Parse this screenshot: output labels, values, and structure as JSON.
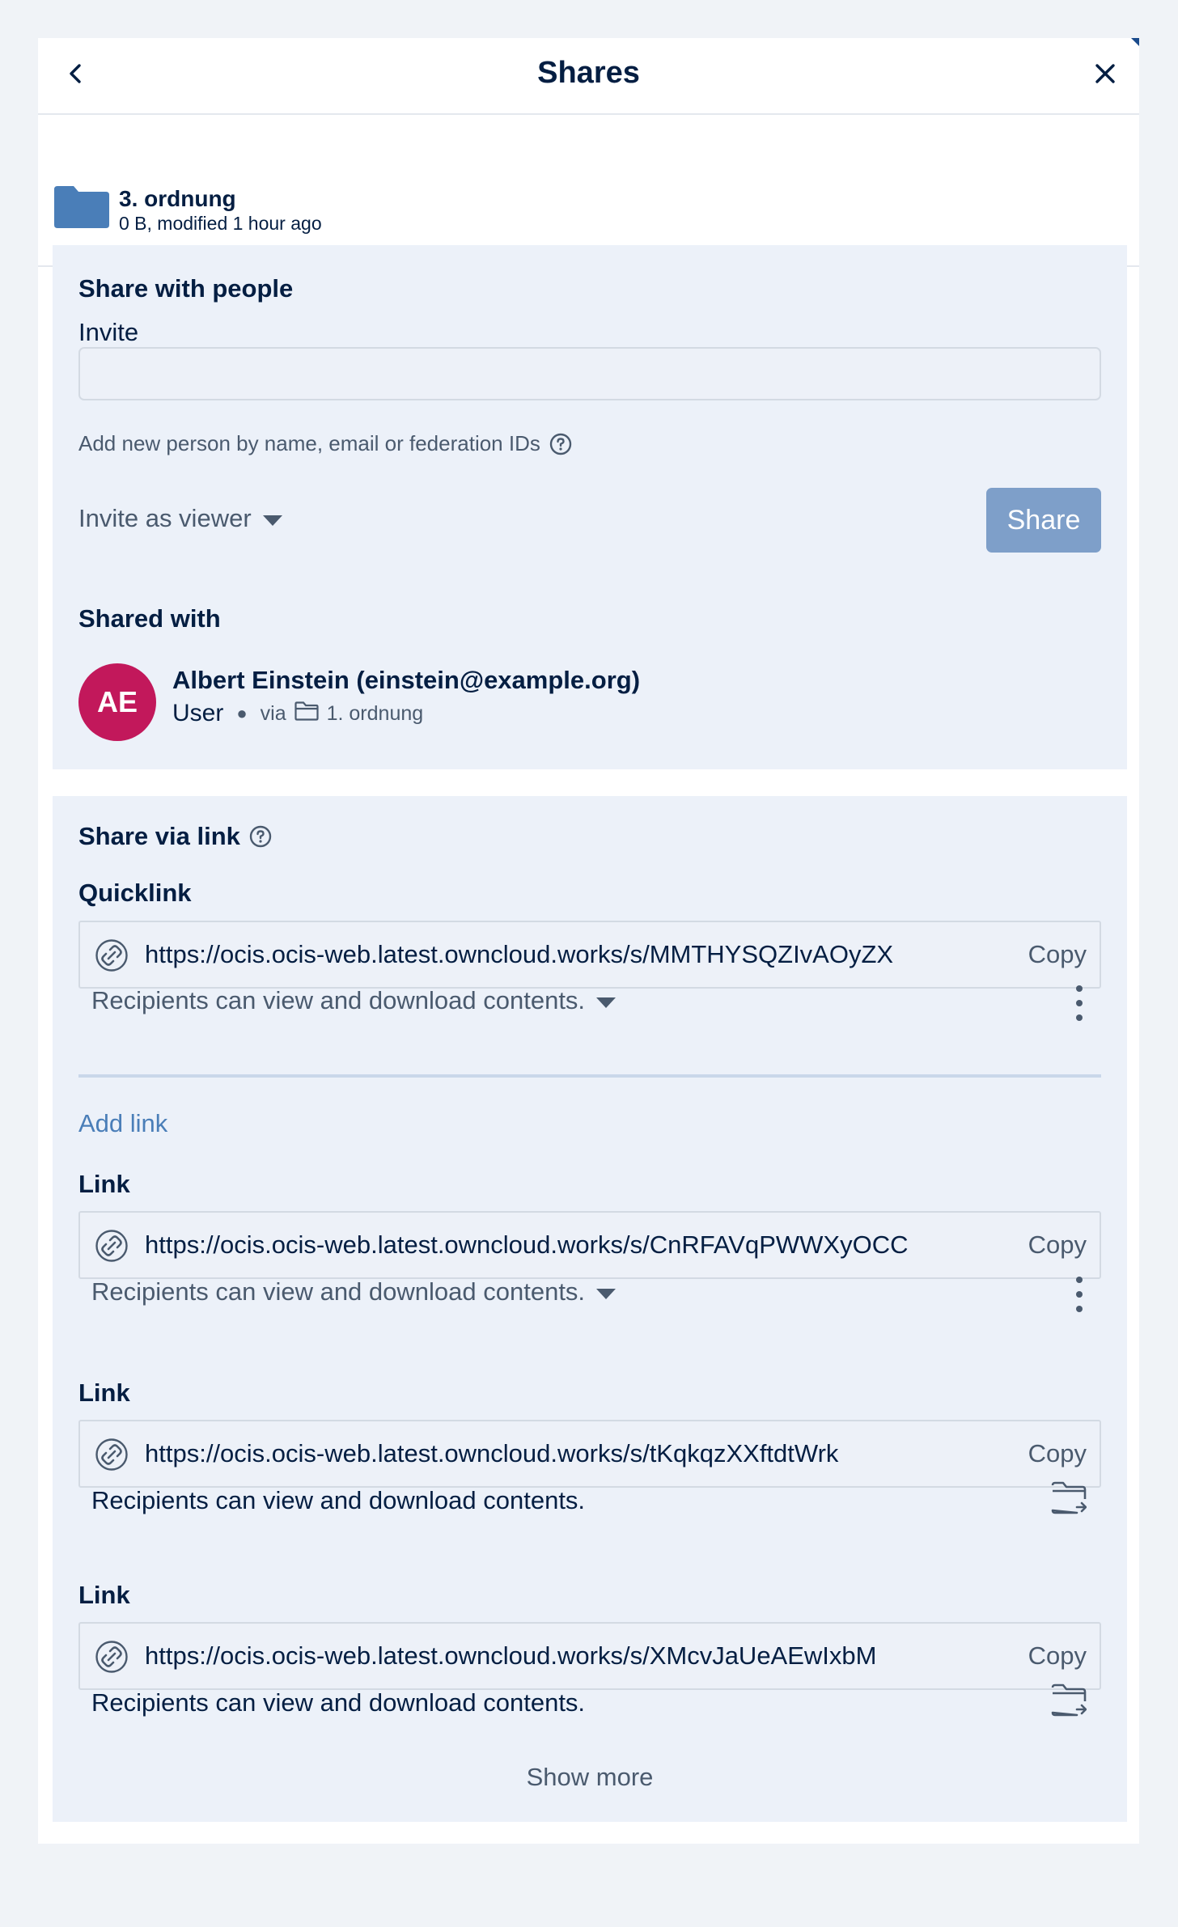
{
  "header": {
    "title": "Shares"
  },
  "file": {
    "name": "3. ordnung",
    "meta": "0 B, modified 1 hour ago"
  },
  "people": {
    "heading": "Share with people",
    "invite_label": "Invite",
    "invite_value": "",
    "hint": "Add new person by name, email or federation IDs",
    "role_select": "Invite as viewer",
    "share_button": "Share",
    "shared_with_heading": "Shared with",
    "collaborators": [
      {
        "initials": "AE",
        "name": "Albert Einstein (einstein@example.org)",
        "role": "User",
        "via_label": "via",
        "via_path": "1. ordnung",
        "avatar_color": "#c2185b"
      }
    ]
  },
  "links": {
    "heading": "Share via link",
    "quicklink_heading": "Quicklink",
    "quicklink": {
      "url": "https://ocis.ocis-web.latest.owncloud.works/s/MMTHYSQZIvAOyZX",
      "copy": "Copy",
      "permission": "Recipients can view and download contents."
    },
    "add_link": "Add link",
    "items": [
      {
        "heading": "Link",
        "url": "https://ocis.ocis-web.latest.owncloud.works/s/CnRFAVqPWWXyOCC",
        "copy": "Copy",
        "permission": "Recipients can view and download contents."
      },
      {
        "heading": "Link",
        "url": "https://ocis.ocis-web.latest.owncloud.works/s/tKqkqzXXftdtWrk",
        "copy": "Copy",
        "permission": "Recipients can view and download contents."
      },
      {
        "heading": "Link",
        "url": "https://ocis.ocis-web.latest.owncloud.works/s/XMcvJaUeAEwIxbM",
        "copy": "Copy",
        "permission": "Recipients can view and download contents."
      }
    ],
    "show_more": "Show more"
  },
  "colors": {
    "background": "#f0f3f7",
    "section_bg": "#ecf1f9",
    "text_primary": "#041e42",
    "text_muted": "#4a5a6e",
    "accent": "#4a7eb8",
    "folder": "#4a7eb8",
    "share_button_disabled": "#7e9fc9"
  },
  "icons": {
    "back": "chevron-left-icon",
    "close": "close-icon",
    "folder": "folder-icon",
    "help": "question-circle-icon",
    "dropdown": "caret-down-icon",
    "link": "link-icon",
    "more": "more-vertical-icon",
    "folder_move": "folder-arrow-icon",
    "via_folder": "folder-outline-icon"
  }
}
